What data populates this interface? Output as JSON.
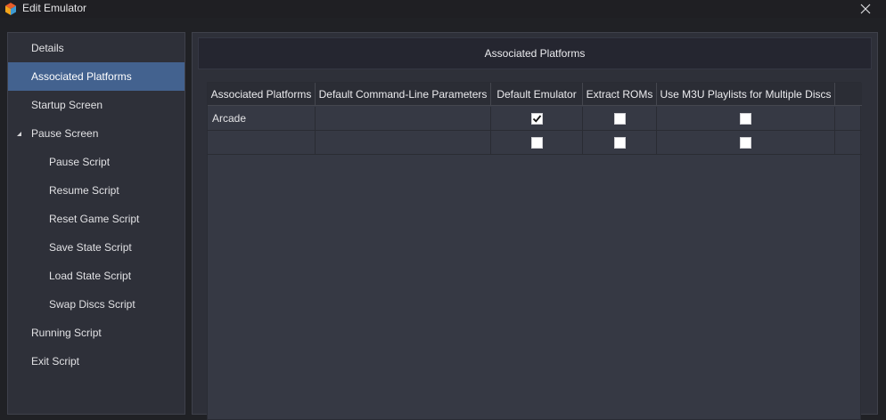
{
  "window": {
    "title": "Edit Emulator",
    "app_icon": "box-icon",
    "close_icon": "close-icon"
  },
  "sidebar": {
    "items": [
      {
        "label": "Details",
        "level": 0,
        "selected": false
      },
      {
        "label": "Associated Platforms",
        "level": 0,
        "selected": true
      },
      {
        "label": "Startup Screen",
        "level": 0,
        "selected": false
      },
      {
        "label": "Pause Screen",
        "level": 0,
        "selected": false,
        "expanded": true
      },
      {
        "label": "Pause Script",
        "level": 1,
        "selected": false
      },
      {
        "label": "Resume Script",
        "level": 1,
        "selected": false
      },
      {
        "label": "Reset Game Script",
        "level": 1,
        "selected": false
      },
      {
        "label": "Save State Script",
        "level": 1,
        "selected": false
      },
      {
        "label": "Load State Script",
        "level": 1,
        "selected": false
      },
      {
        "label": "Swap Discs Script",
        "level": 1,
        "selected": false
      },
      {
        "label": "Running Script",
        "level": 0,
        "selected": false
      },
      {
        "label": "Exit Script",
        "level": 0,
        "selected": false
      }
    ]
  },
  "main": {
    "header": "Associated Platforms",
    "table": {
      "columns": [
        "Associated Platforms",
        "Default Command-Line Parameters",
        "Default Emulator",
        "Extract ROMs",
        "Use M3U Playlists for Multiple Discs"
      ],
      "rows": [
        {
          "platform": "Arcade",
          "params": "",
          "default_emulator": true,
          "extract_roms": false,
          "use_m3u": false
        },
        {
          "platform": "",
          "params": "",
          "default_emulator": false,
          "extract_roms": false,
          "use_m3u": false
        }
      ]
    }
  },
  "colors": {
    "selected_item": "#43628f",
    "panel": "#2e3039",
    "grid": "#363944"
  }
}
